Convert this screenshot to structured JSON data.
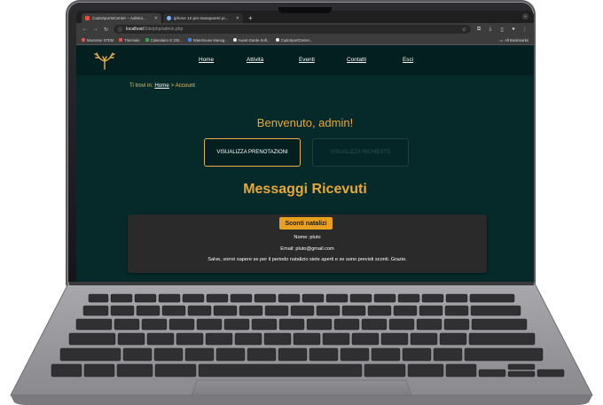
{
  "browser": {
    "tabs": [
      {
        "label": "CadoSportsCenter – Admini...",
        "active": true
      },
      {
        "label": "iphone 12 pro transparent pi...",
        "active": false
      }
    ],
    "new_tab": "+",
    "address": {
      "host": "localhost",
      "path": "/Site/php/admin.php"
    },
    "bookmarks": [
      {
        "label": "Macrame STEM",
        "color": "#d9534f"
      },
      {
        "label": "Triennale",
        "color": "#e5533d"
      },
      {
        "label": "Calendario G 202...",
        "color": "#34a853"
      },
      {
        "label": "Warehouse Manag...",
        "color": "#4285f4"
      },
      {
        "label": "Avant-Garde-Soft...",
        "color": "#f0f0f0"
      },
      {
        "label": "CadoSportCenter...",
        "color": "#f0f0f0"
      }
    ],
    "all_bookmarks": "All Bookmarks"
  },
  "nav": {
    "items": [
      "Home",
      "Attività",
      "Eventi",
      "Contatti",
      "Esci"
    ]
  },
  "breadcrumb": {
    "prefix": "Ti trovi in:",
    "home": "Home",
    "separator": ">",
    "current": "Account"
  },
  "welcome": "Benvenuto, admin!",
  "buttons": {
    "bookings": "VISUALIZZA PRENOTAZIONI",
    "requests": "VISUALIZZA RICHIESTE"
  },
  "messages": {
    "title": "Messaggi Ricevuti",
    "items": [
      {
        "subject": "Sconti natalizi",
        "name": "Nome: pluto",
        "email": "Email: pluto@gmail.com",
        "body": "Salve, vorrei sapere se per il periodo natalizio siete aperti e se sono previsti sconti. Grazie."
      }
    ]
  },
  "colors": {
    "accent": "#e8a838",
    "background": "#062a2a",
    "header": "#041f1f",
    "card": "#2a2a2a"
  }
}
